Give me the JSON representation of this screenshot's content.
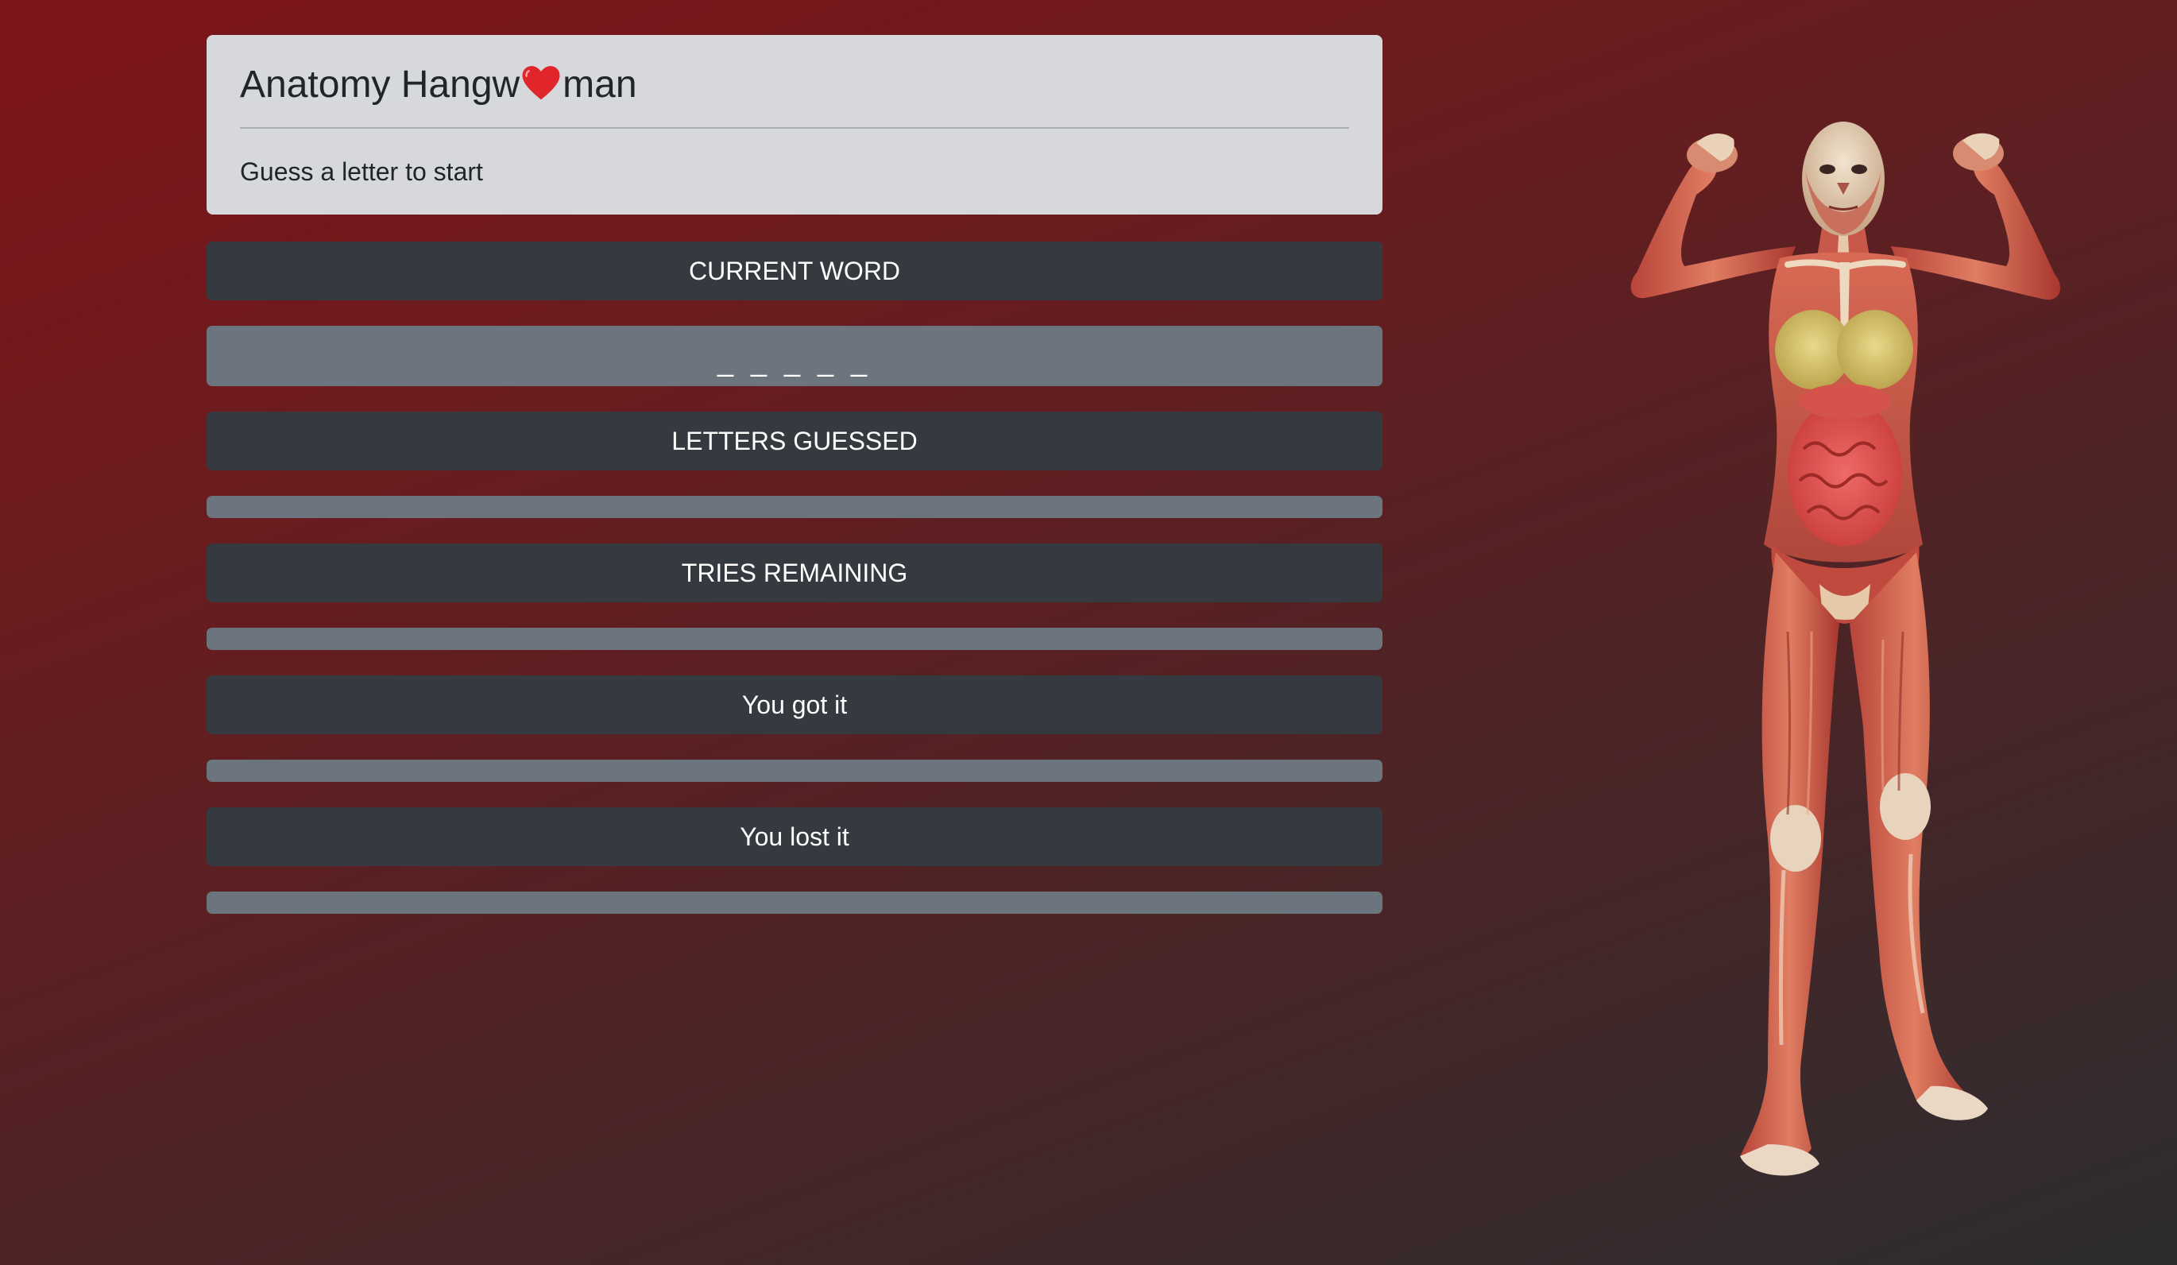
{
  "header": {
    "title_before": "Anatomy Hangw",
    "title_icon": "heart-icon",
    "title_after": "man",
    "subtitle": "Guess a letter to start"
  },
  "sections": {
    "current_word_label": "CURRENT WORD",
    "current_word_value": "_ _ _ _ _",
    "letters_guessed_label": "LETTERS GUESSED",
    "letters_guessed_value": "",
    "tries_remaining_label": "TRIES REMAINING",
    "tries_remaining_value": "",
    "win_label": "You got it",
    "win_value": "",
    "loss_label": "You lost it",
    "loss_value": ""
  },
  "colors": {
    "accent_heart": "#e0262b",
    "panel_dark": "#343a40",
    "panel_gray": "#6c757d",
    "jumbotron": "#d6d8db"
  },
  "illustration": {
    "icon": "anatomy-figure-image"
  }
}
